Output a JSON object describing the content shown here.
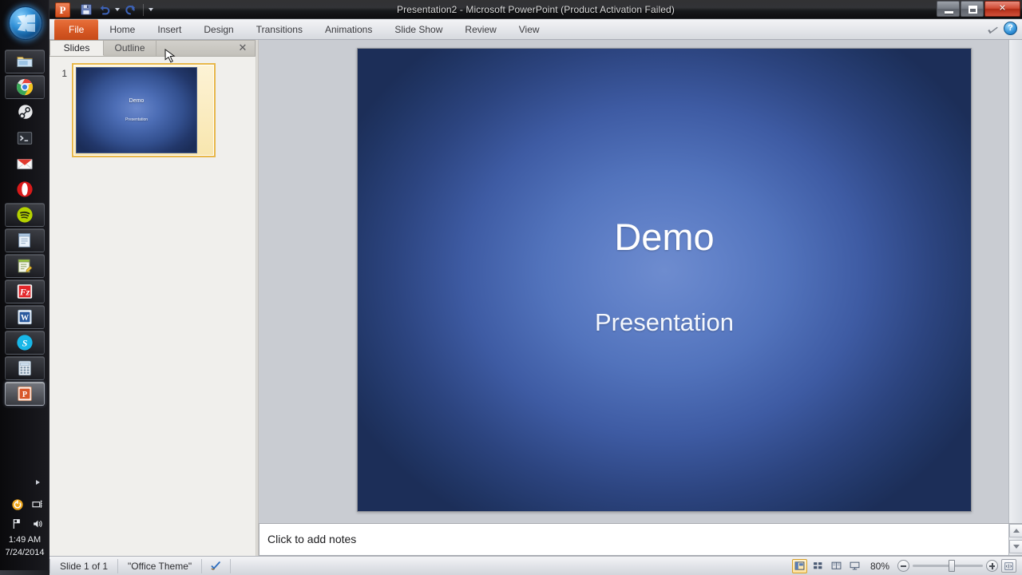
{
  "window": {
    "title": "Presentation2  -  Microsoft PowerPoint (Product Activation Failed)",
    "app_logo_letter": "P",
    "minimize_label": "Minimize",
    "restore_label": "Restore Down",
    "close_label": "✕"
  },
  "quick_access": {
    "items": [
      {
        "name": "save-button",
        "icon": "save-icon",
        "label": "Save"
      },
      {
        "name": "undo-button",
        "icon": "undo-icon",
        "label": "Undo"
      },
      {
        "name": "redo-button",
        "icon": "redo-icon",
        "label": "Repeat"
      },
      {
        "name": "customize-qat-button",
        "icon": "chevron-down-icon",
        "label": "Customize Quick Access Toolbar"
      }
    ]
  },
  "ribbon": {
    "tabs": [
      {
        "label": "File",
        "active": true
      },
      {
        "label": "Home",
        "active": false
      },
      {
        "label": "Insert",
        "active": false
      },
      {
        "label": "Design",
        "active": false
      },
      {
        "label": "Transitions",
        "active": false
      },
      {
        "label": "Animations",
        "active": false
      },
      {
        "label": "Slide Show",
        "active": false
      },
      {
        "label": "Review",
        "active": false
      },
      {
        "label": "View",
        "active": false
      }
    ],
    "minimize_ribbon_label": "Minimize the Ribbon",
    "help_label": "?"
  },
  "panel": {
    "tab_slides": "Slides",
    "tab_outline": "Outline",
    "close_label": "✕",
    "slides": [
      {
        "number": "1",
        "title": "Demo",
        "subtitle": "Presentation",
        "selected": true
      }
    ]
  },
  "slide": {
    "title": "Demo",
    "subtitle": "Presentation"
  },
  "notes": {
    "placeholder": "Click to add notes"
  },
  "status": {
    "slide_count": "Slide 1 of 1",
    "theme": "\"Office Theme\"",
    "spellcheck_icon": "spellcheck-icon",
    "zoom": "80%",
    "zoom_out_label": "Zoom Out",
    "zoom_in_label": "Zoom In",
    "fit_label": "Fit slide to current window",
    "views": [
      {
        "name": "normal-view-button",
        "label": "Normal",
        "active": true
      },
      {
        "name": "slide-sorter-view-button",
        "label": "Slide Sorter",
        "active": false
      },
      {
        "name": "reading-view-button",
        "label": "Reading View",
        "active": false
      },
      {
        "name": "slide-show-button",
        "label": "Slide Show",
        "active": false
      }
    ]
  },
  "taskbar": {
    "start_label": "Start",
    "items": [
      {
        "name": "taskbar-windows-explorer",
        "icon": "folder-icon",
        "label": "Windows Explorer",
        "state": "pinned"
      },
      {
        "name": "taskbar-google-chrome",
        "icon": "chrome-icon",
        "label": "Google Chrome",
        "state": "pinned"
      },
      {
        "name": "taskbar-steam",
        "icon": "steam-icon",
        "label": "Steam",
        "state": "plain"
      },
      {
        "name": "taskbar-command-prompt",
        "icon": "command-prompt-icon",
        "label": "Command Prompt",
        "state": "plain"
      },
      {
        "name": "taskbar-mail",
        "icon": "mail-icon",
        "label": "Mail",
        "state": "plain"
      },
      {
        "name": "taskbar-opera",
        "icon": "opera-icon",
        "label": "Opera",
        "state": "plain"
      },
      {
        "name": "taskbar-spotify",
        "icon": "spotify-icon",
        "label": "Spotify",
        "state": "pinned"
      },
      {
        "name": "taskbar-notepad",
        "icon": "notepad-icon",
        "label": "Notepad",
        "state": "pinned"
      },
      {
        "name": "taskbar-notepad-plus-plus",
        "icon": "notepad-plus-plus-icon",
        "label": "Notepad++",
        "state": "pinned"
      },
      {
        "name": "taskbar-filezilla",
        "icon": "filezilla-icon",
        "label": "FileZilla",
        "state": "pinned"
      },
      {
        "name": "taskbar-word",
        "icon": "word-icon",
        "label": "Microsoft Word",
        "state": "pinned"
      },
      {
        "name": "taskbar-skype",
        "icon": "skype-icon",
        "label": "Skype",
        "state": "pinned"
      },
      {
        "name": "taskbar-calculator",
        "icon": "calculator-icon",
        "label": "Calculator",
        "state": "pinned"
      },
      {
        "name": "taskbar-powerpoint",
        "icon": "powerpoint-icon",
        "label": "Microsoft PowerPoint",
        "state": "active"
      }
    ],
    "tray": {
      "show_hidden_label": "Show hidden icons",
      "icons": [
        {
          "name": "tray-update-icon",
          "label": "Update"
        },
        {
          "name": "tray-network-icon",
          "label": "Network"
        },
        {
          "name": "tray-action-center-icon",
          "label": "Action Center"
        },
        {
          "name": "tray-volume-icon",
          "label": "Volume"
        }
      ],
      "time": "1:49 AM",
      "date": "7/24/2014"
    }
  }
}
